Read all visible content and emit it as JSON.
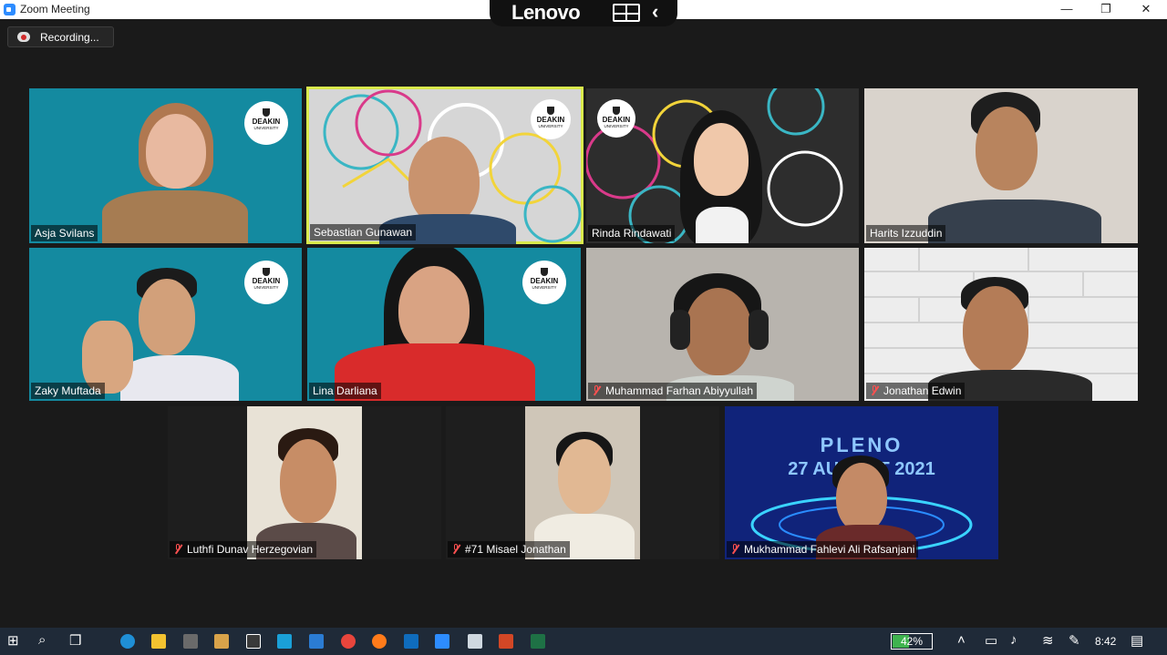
{
  "window": {
    "title": "Zoom Meeting",
    "minimize": "—",
    "restore": "❐",
    "close": "✕"
  },
  "banner": {
    "brand": "Lenovo"
  },
  "recording": {
    "label": "Recording..."
  },
  "participants": [
    {
      "name": "Asja Svilans",
      "muted": false,
      "active": false,
      "logo": true
    },
    {
      "name": "Sebastian Gunawan",
      "muted": false,
      "active": true,
      "logo": true
    },
    {
      "name": "Rinda Rindawati",
      "muted": false,
      "active": false,
      "logo": true
    },
    {
      "name": "Harits Izzuddin",
      "muted": false,
      "active": false,
      "logo": false
    },
    {
      "name": "Zaky Muftada",
      "muted": false,
      "active": false,
      "logo": true
    },
    {
      "name": "Lina Darliana",
      "muted": false,
      "active": false,
      "logo": true
    },
    {
      "name": "Muhammad Farhan Abiyyullah",
      "muted": true,
      "active": false,
      "logo": false
    },
    {
      "name": "Jonathan Edwin",
      "muted": true,
      "active": false,
      "logo": false
    },
    {
      "name": "Luthfi Dunav Herzegovian",
      "muted": true,
      "active": false,
      "logo": false
    },
    {
      "name": "#71 Misael Jonathan",
      "muted": true,
      "active": false,
      "logo": false
    },
    {
      "name": "Mukhammad Fahlevi Ali Rafsanjani",
      "muted": true,
      "active": false,
      "logo": false
    }
  ],
  "deakin_logo": {
    "name": "DEAKIN",
    "sub": "UNIVERSITY"
  },
  "background_banner": {
    "line1": "PLENO",
    "line2": "27 AUGUST 2021"
  },
  "taskbar": {
    "battery_percent": "42%",
    "battery_level": 0.42,
    "time": "8:42"
  },
  "colors": {
    "meeting_bg": "#1a1a1a",
    "deakin_teal": "#148aa0",
    "active_speaker": "#d9e94c",
    "muted_red": "#ff5050",
    "taskbar": "#1f2a38"
  }
}
